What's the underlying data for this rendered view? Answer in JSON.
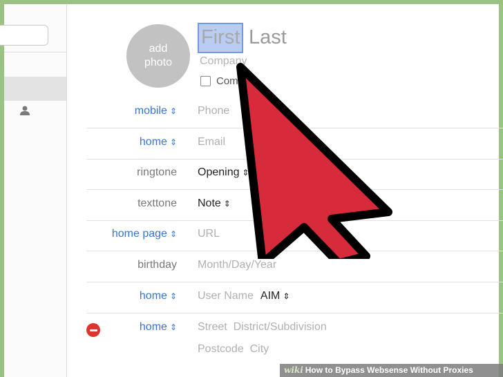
{
  "avatar": {
    "line1": "add",
    "line2": "photo"
  },
  "name": {
    "first": "First",
    "last": "Last"
  },
  "company": {
    "placeholder": "Company",
    "checkbox_label": "Com"
  },
  "rows": [
    {
      "label": "mobile",
      "label_color": "blue",
      "value": "Phone",
      "value_style": "placeholder"
    },
    {
      "label": "home",
      "label_color": "blue",
      "value": "Email",
      "value_style": "placeholder"
    },
    {
      "label": "ringtone",
      "label_color": "gray",
      "value": "Opening",
      "value_style": "set"
    },
    {
      "label": "texttone",
      "label_color": "gray",
      "value": "Note",
      "value_style": "set"
    },
    {
      "label": "home page",
      "label_color": "blue",
      "value": "URL",
      "value_style": "placeholder"
    },
    {
      "label": "birthday",
      "label_color": "gray",
      "value": "Month/Day/Year",
      "value_style": "placeholder"
    },
    {
      "label": "home",
      "label_color": "blue",
      "value": "User Name",
      "value_style": "placeholder",
      "service": "AIM"
    },
    {
      "label": "home",
      "label_color": "blue",
      "value": "Street  District/Subdivision",
      "value_style": "placeholder"
    }
  ],
  "address_line2": "Postcode  City",
  "stepper_glyph": "⇕",
  "colors": {
    "accent": "#3674d1",
    "delete": "#d9362d",
    "cursor": "#d72a3a",
    "frame": "#9cc184"
  },
  "icons": [
    "person-icon",
    "delete-icon",
    "arrow-cursor-icon"
  ],
  "watermark": {
    "brand": "wiki",
    "text": "How to Bypass Websense Without Proxies"
  }
}
